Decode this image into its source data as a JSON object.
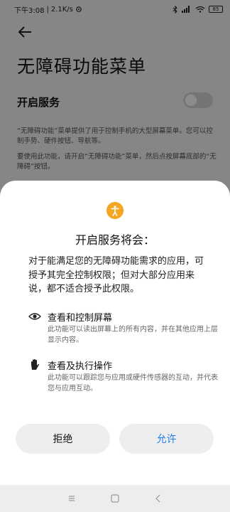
{
  "status_bar": {
    "time": "下午3:08",
    "speed": "2.1K/s",
    "battery": "85"
  },
  "page": {
    "title": "无障碍功能菜单",
    "service_label": "开启服务",
    "toggle_on": false,
    "description_1": "“无障碍功能”菜单提供了用于控制手机的大型屏幕菜单。您可以控制手势、硬件按钮、导航等。",
    "description_2": "要使用此功能，请开启“无障碍功能”菜单，然后点按屏幕底部的“无障碍”按钮。"
  },
  "dialog": {
    "icon": "accessibility-icon",
    "title": "开启服务将会：",
    "intro": "对于能满足您的无障碍功能需求的应用，可授予其完全控制权限；但对大部分应用来说，都不适合授予此权限。",
    "permissions": [
      {
        "icon": "eye-icon",
        "title": "查看和控制屏幕",
        "description": "此功能可以读出屏幕上的所有内容，并在其他应用上层显示内容。"
      },
      {
        "icon": "hand-icon",
        "title": "查看及执行操作",
        "description": "此功能可以跟踪您与应用或硬件传感器的互动，并代表您与应用互动。"
      }
    ],
    "deny_label": "拒绝",
    "allow_label": "允许"
  },
  "colors": {
    "accent": "#1f7fe6",
    "accessibility_icon": "#f5a623"
  }
}
